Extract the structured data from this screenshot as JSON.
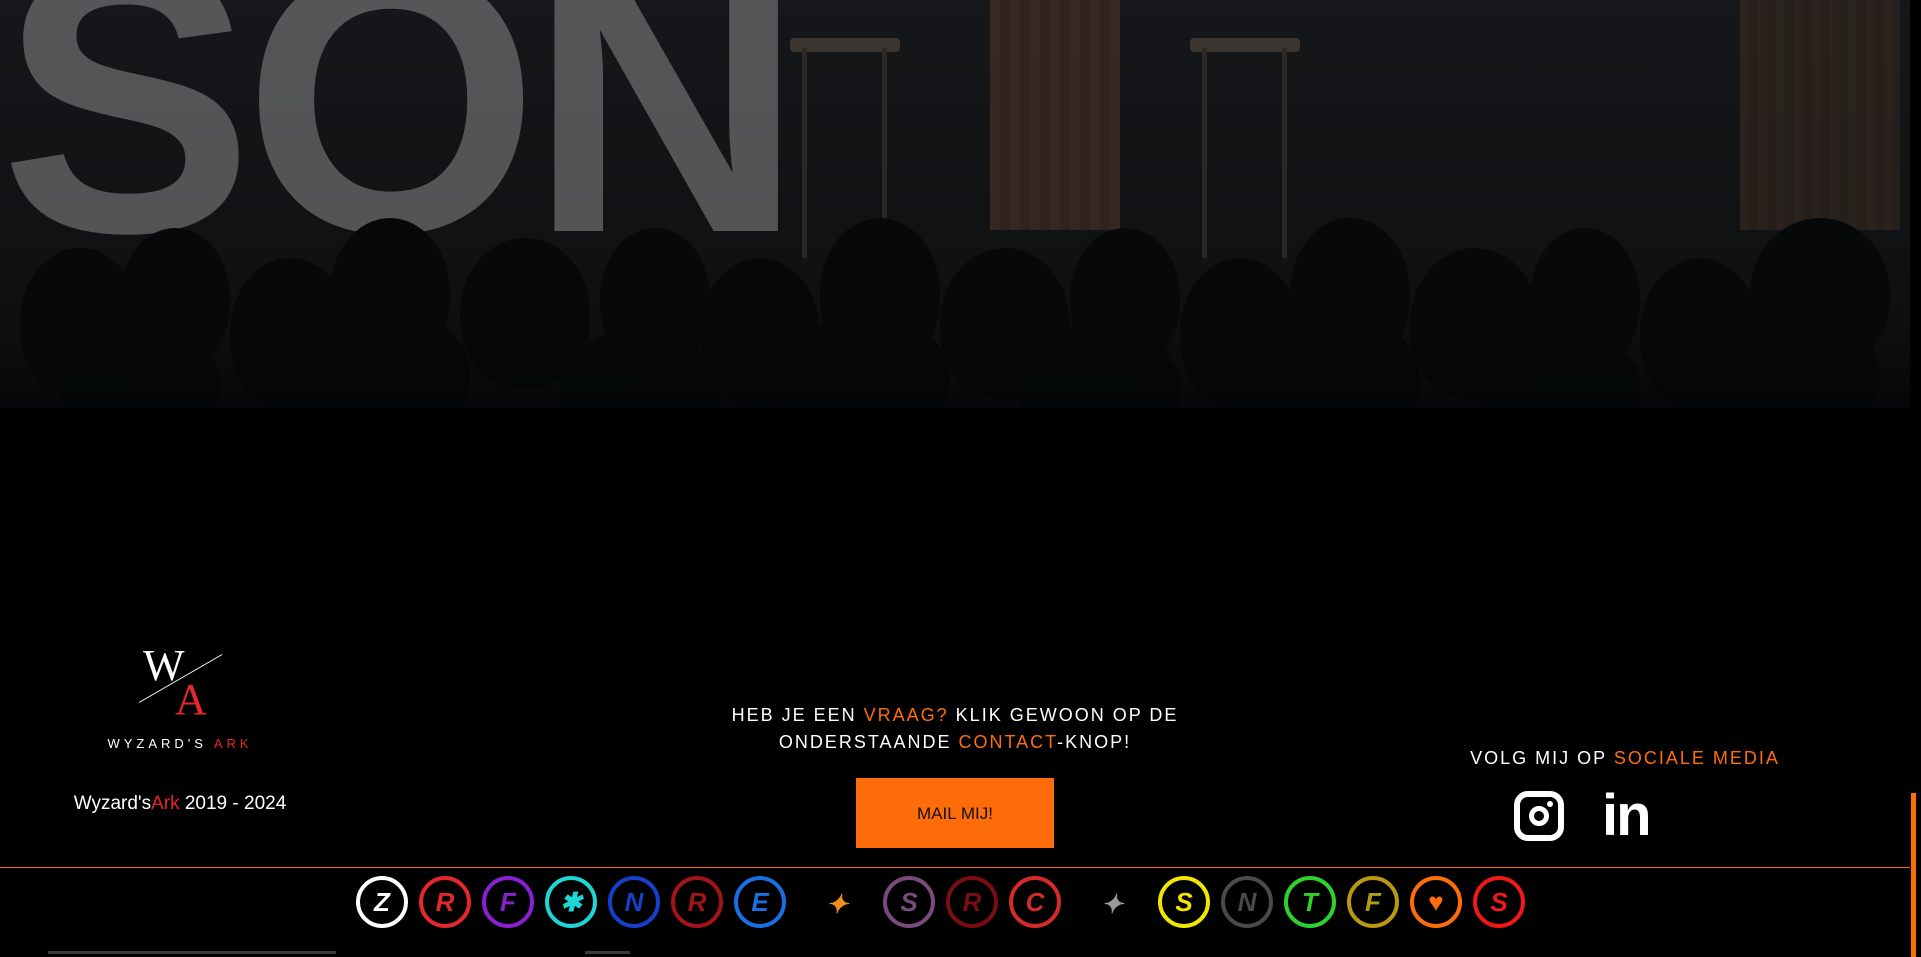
{
  "footer": {
    "logo": {
      "mark_top": "W",
      "mark_bottom": "A",
      "name_white": "WYZARD'S",
      "name_red": "ARK"
    },
    "copyright": {
      "white": "Wyzard's",
      "red": "Ark",
      "years": "2019 - 2024"
    },
    "cta": {
      "line1_pre": "HEB JE EEN ",
      "line1_accent": "VRAAG?",
      "line1_post": " KLIK GEWOON OP DE",
      "line2_pre": "ONDERSTAANDE ",
      "line2_accent": "CONTACT",
      "line2_post": "-KNOP!",
      "button_label": "MAIL MIJ!"
    },
    "social": {
      "title_pre": "VOLG MIJ OP ",
      "title_accent": "SOCIALE MEDIA",
      "icons": [
        "instagram-icon",
        "linkedin-icon"
      ],
      "linkedin_text": "in"
    }
  },
  "hero": {
    "sign_letters": "SON"
  },
  "badges": [
    {
      "icon": "white-badge-icon",
      "color": "#ffffff",
      "glyph": "Z"
    },
    {
      "icon": "red-badge-icon",
      "color": "#e3272d",
      "glyph": "R"
    },
    {
      "icon": "purple-badge-icon",
      "color": "#8a1fd1",
      "glyph": "F"
    },
    {
      "icon": "cyan-badge-icon",
      "color": "#1fd6d6",
      "glyph": "✱"
    },
    {
      "icon": "blue-badge-icon",
      "color": "#1640c9",
      "glyph": "N"
    },
    {
      "icon": "darkred-badge-icon",
      "color": "#a0141a",
      "glyph": "R"
    },
    {
      "icon": "blue-e-badge-icon",
      "color": "#1a6fe3",
      "glyph": "E"
    },
    {
      "icon": "orange-wing-badge-icon",
      "color": "#f0901a",
      "glyph": "✦"
    },
    {
      "icon": "purple-s-badge-icon",
      "color": "#7a4a7a",
      "glyph": "S"
    },
    {
      "icon": "dark-r-badge-icon",
      "color": "#7a0d12",
      "glyph": "R"
    },
    {
      "icon": "red-c-badge-icon",
      "color": "#d42a2a",
      "glyph": "C"
    },
    {
      "icon": "silver-wing-badge-icon",
      "color": "#9a9a9a",
      "glyph": "✦"
    },
    {
      "icon": "yellow-badge-icon",
      "color": "#f2e600",
      "glyph": "S"
    },
    {
      "icon": "grey-n-badge-icon",
      "color": "#4a4a4a",
      "glyph": "N"
    },
    {
      "icon": "green-badge-icon",
      "color": "#2fd12f",
      "glyph": "T"
    },
    {
      "icon": "gold-badge-icon",
      "color": "#b89a12",
      "glyph": "F"
    },
    {
      "icon": "orange-heart-badge-icon",
      "color": "#ff6d0a",
      "glyph": "♥"
    },
    {
      "icon": "red-s-badge-icon",
      "color": "#f01818",
      "glyph": "S"
    }
  ]
}
